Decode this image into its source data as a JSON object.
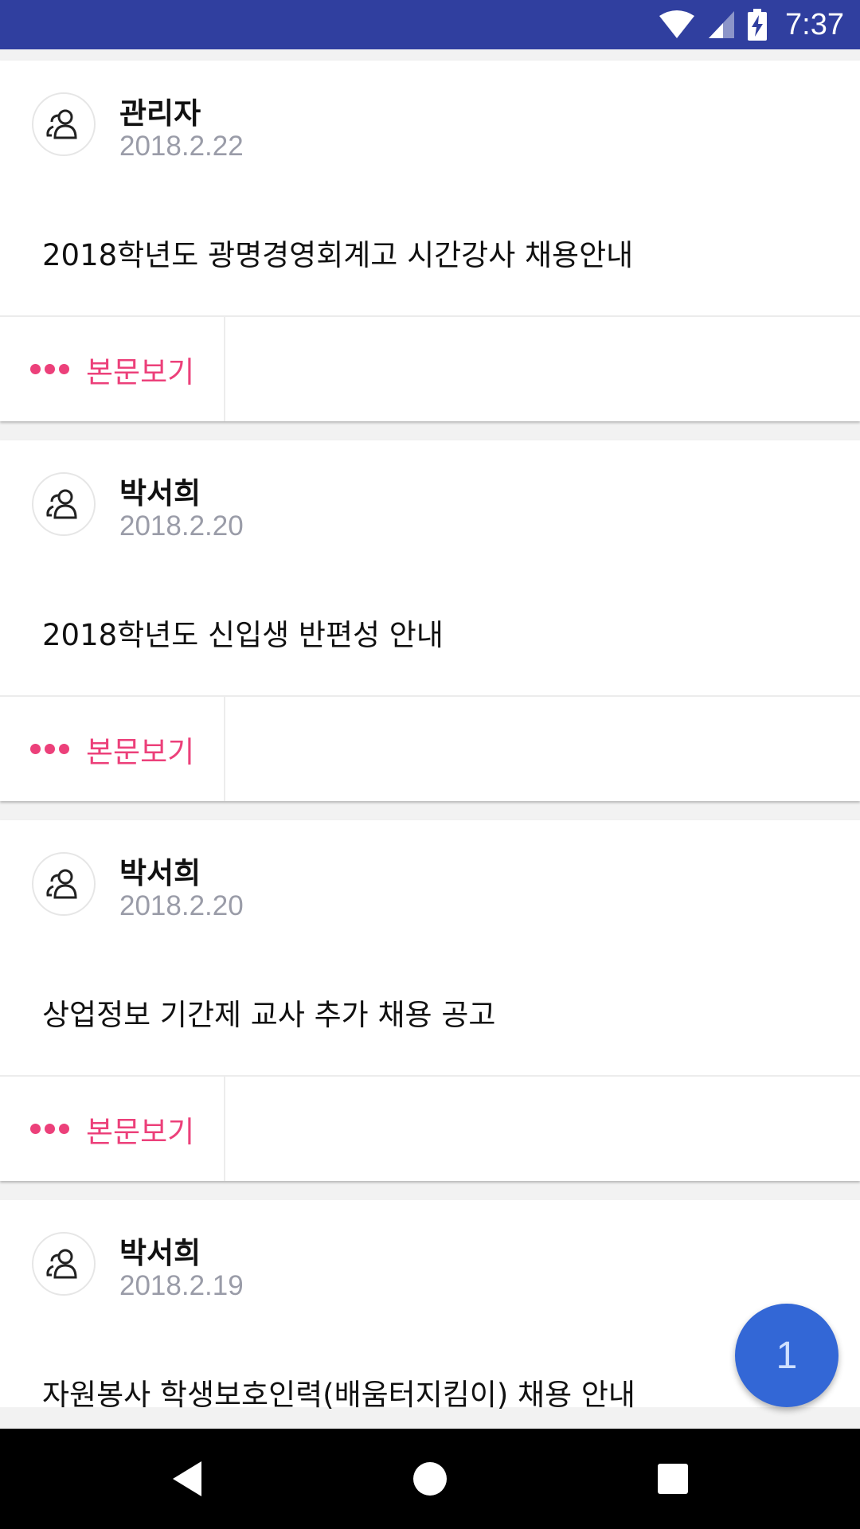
{
  "status_bar": {
    "time": "7:37",
    "icons": [
      "wifi-icon",
      "cell-signal-icon",
      "battery-charging-icon"
    ]
  },
  "posts": [
    {
      "author": "관리자",
      "date": "2018.2.22",
      "title": "2018학년도 광명경영회계고 시간강사 채용안내",
      "view_label": "본문보기"
    },
    {
      "author": "박서희",
      "date": "2018.2.20",
      "title": "2018학년도 신입생 반편성 안내",
      "view_label": "본문보기"
    },
    {
      "author": "박서희",
      "date": "2018.2.20",
      "title": "상업정보 기간제 교사 추가 채용 공고",
      "view_label": "본문보기"
    },
    {
      "author": "박서희",
      "date": "2018.2.19",
      "title": "자원봉사 학생보호인력(배움터지킴이) 채용 안내"
    }
  ],
  "fab": {
    "label": "1"
  },
  "colors": {
    "status_bar": "#303f9f",
    "accent_pink": "#ec407a",
    "fab": "#3367d6"
  },
  "nav_bar": {
    "icons": [
      "back-icon",
      "home-icon",
      "recents-icon"
    ]
  }
}
